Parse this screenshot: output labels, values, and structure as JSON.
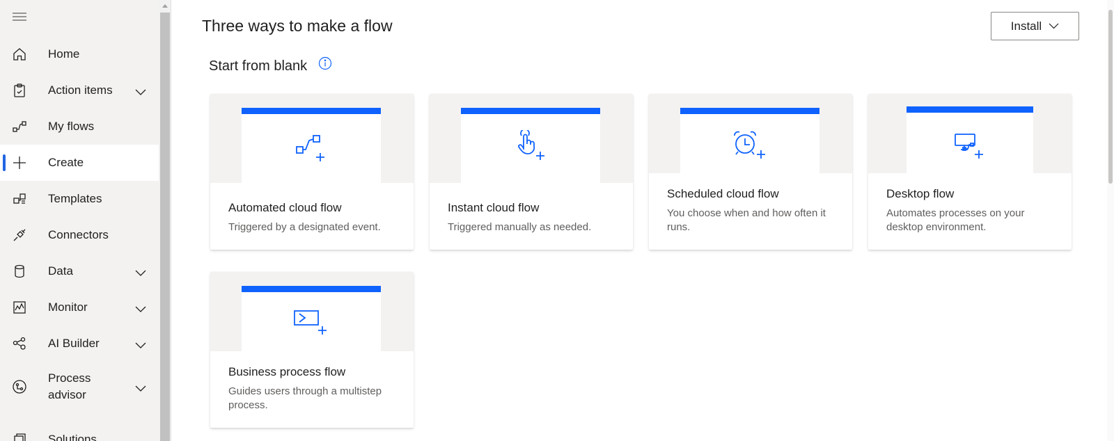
{
  "sidebar": {
    "items": [
      {
        "label": "Home",
        "icon": "home-icon",
        "chevron": false
      },
      {
        "label": "Action items",
        "icon": "clipboard-icon",
        "chevron": true
      },
      {
        "label": "My flows",
        "icon": "flow-icon",
        "chevron": false
      },
      {
        "label": "Create",
        "icon": "plus-icon",
        "chevron": false,
        "active": true
      },
      {
        "label": "Templates",
        "icon": "templates-icon",
        "chevron": false
      },
      {
        "label": "Connectors",
        "icon": "connector-icon",
        "chevron": false
      },
      {
        "label": "Data",
        "icon": "database-icon",
        "chevron": true
      },
      {
        "label": "Monitor",
        "icon": "monitor-chart-icon",
        "chevron": true
      },
      {
        "label": "AI Builder",
        "icon": "ai-builder-icon",
        "chevron": true
      },
      {
        "label": "Process advisor",
        "icon": "process-advisor-icon",
        "chevron": true
      },
      {
        "label": "Solutions",
        "icon": "solutions-icon",
        "chevron": false
      }
    ]
  },
  "header": {
    "title": "Three ways to make a flow",
    "install_label": "Install"
  },
  "section": {
    "title": "Start from blank"
  },
  "cards": [
    {
      "title": "Automated cloud flow",
      "description": "Triggered by a designated event.",
      "icon": "automated-flow-icon"
    },
    {
      "title": "Instant cloud flow",
      "description": "Triggered manually as needed.",
      "icon": "touch-hand-icon"
    },
    {
      "title": "Scheduled cloud flow",
      "description": "You choose when and how often it runs.",
      "icon": "alarm-clock-icon"
    },
    {
      "title": "Desktop flow",
      "description": "Automates processes on your desktop environment.",
      "icon": "desktop-flow-icon"
    },
    {
      "title": "Business process flow",
      "description": "Guides users through a multistep process.",
      "icon": "business-process-icon"
    }
  ],
  "colors": {
    "accent": "#0f62fe",
    "sidebar_bg": "#f3f2f1",
    "card_hero_bg": "#f3f2f1"
  }
}
